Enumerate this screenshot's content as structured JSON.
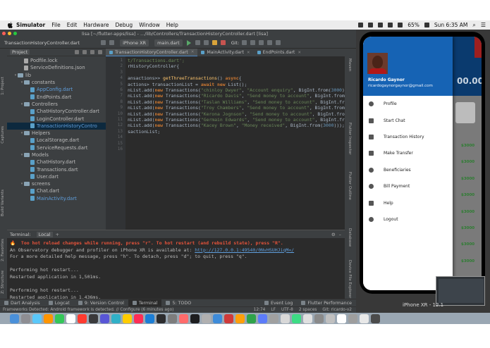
{
  "menubar": {
    "app": "Simulator",
    "items": [
      "File",
      "Edit",
      "Hardware",
      "Debug",
      "Window",
      "Help"
    ],
    "battery": "65%",
    "clock": "Sun 6:35 AM"
  },
  "ide": {
    "window_title": "lisa [~/flutter-apps/lisa] - .../lib/Controllers/TransactionHistoryController.dart [lisa]",
    "breadcrumb": "TransactionHistoryController.dart",
    "device": "iPhone XR",
    "run_config": "main.dart",
    "git_label": "Git:",
    "project_view": "Project",
    "tree": [
      {
        "label": "Podfile.lock",
        "type": "file",
        "indent": 2
      },
      {
        "label": "ServiceDefinitions.json",
        "type": "file",
        "indent": 2
      },
      {
        "label": "lib",
        "type": "folder",
        "indent": 1,
        "arrow": "▾"
      },
      {
        "label": "constants",
        "type": "folder",
        "indent": 2,
        "arrow": "▾"
      },
      {
        "label": "AppConfig.dart",
        "type": "dart",
        "indent": 3,
        "link": true
      },
      {
        "label": "EndPoints.dart",
        "type": "dart",
        "indent": 3
      },
      {
        "label": "Controllers",
        "type": "folder",
        "indent": 2,
        "arrow": "▾"
      },
      {
        "label": "ChatHistoryController.dart",
        "type": "dart",
        "indent": 3
      },
      {
        "label": "LoginController.dart",
        "type": "dart",
        "indent": 3
      },
      {
        "label": "TransactionHistoryContro",
        "type": "dart",
        "indent": 3,
        "selected": true,
        "link": true
      },
      {
        "label": "Helpers",
        "type": "folder",
        "indent": 2,
        "arrow": "▾"
      },
      {
        "label": "LocalStorage.dart",
        "type": "dart",
        "indent": 3
      },
      {
        "label": "ServiceRequests.dart",
        "type": "dart",
        "indent": 3
      },
      {
        "label": "Models",
        "type": "folder",
        "indent": 2,
        "arrow": "▾"
      },
      {
        "label": "ChatHistory.dart",
        "type": "dart",
        "indent": 3
      },
      {
        "label": "Transactions.dart",
        "type": "dart",
        "indent": 3
      },
      {
        "label": "User.dart",
        "type": "dart",
        "indent": 3
      },
      {
        "label": "screens",
        "type": "folder",
        "indent": 2,
        "arrow": "▾"
      },
      {
        "label": "Chat.dart",
        "type": "dart",
        "indent": 3
      },
      {
        "label": "MainActivity.dart",
        "type": "dart",
        "indent": 3,
        "link": true
      }
    ],
    "tabs": [
      "TransactionHistoryController.dart",
      "MainActivity.dart",
      "EndPoints.dart"
    ],
    "line_numbers": [
      "1",
      "2",
      "3",
      "4",
      "5",
      "6",
      "7",
      "8",
      "9",
      "10",
      "11",
      "12",
      "13",
      "14",
      "15",
      "16"
    ],
    "code": {
      "l1": "t/Transactions.dart';",
      "l2": "rHistoryController{",
      "l4_a": "ansactions>> ",
      "l4_fn": "getThreeTransactions",
      "l4_b": "() ",
      "l4_kw": "async",
      "l4_c": "{",
      "l5_a": "actions> transactionList = ",
      "l5_kw1": "await",
      "l5_kw2": "new",
      "l5_b": " List();",
      "rows": [
        {
          "name": "\"chinloy Dwyer\"",
          "msg": "\"Account enquiry\""
        },
        {
          "name": "\"Ricardo Davis\"",
          "msg": "\"Send money to account\""
        },
        {
          "name": "\"Taslan Williams\"",
          "msg": "\"Send money to account\""
        },
        {
          "name": "\"Troy Chambers\"",
          "msg": "\"Send money to account\""
        },
        {
          "name": "\"Kerona Jognson\"",
          "msg": "\"Send money to account\""
        },
        {
          "name": "\"Germain Edwards\"",
          "msg": "\"Send money to account\""
        },
        {
          "name": "\"Kacey Brown\"",
          "msg": "\"Money received\""
        }
      ],
      "last_num": "3000",
      "l14": "sactionList;"
    },
    "terminal": {
      "title": "Terminal:",
      "session": "Local",
      "lines": {
        "warn": "Too hot reload changes while running, press \"r\". To hot restart (and rebuild state), press \"R\".",
        "obs_a": "An Observatory debugger and profiler on iPhone XR is available at: ",
        "obs_url": "http://127.0.0.1:49540/0NvHSUHJiqM=/",
        "help": "For a more detailed help message, press \"h\". To detach, press \"d\"; to quit, press \"q\".",
        "p1": "Performing hot restart...",
        "r1": "Restarted application in 1,501ms.",
        "p2": "Performing hot restart...",
        "r2": "Restarted application in 1,436ms."
      }
    },
    "tool_tabs": [
      "Dart Analysis",
      "Logcat",
      "9: Version Control",
      "Terminal",
      "5: TODO",
      "Event Log",
      "Flutter Performance"
    ],
    "status_left": "Frameworks Detected: Android framework is detected. // Configure (6 minutes ago)",
    "status_right": [
      "12:74",
      "LF",
      "UTF-8",
      "2 spaces",
      "Git: ricardo-v2"
    ],
    "left_strip": [
      "1: Project",
      "Captures",
      "Build Variants",
      "2: Favorites",
      "Z: Structure"
    ],
    "right_strip": [
      "Maven",
      "Flutter Inspector",
      "Flutter Outline",
      "Database",
      "Device File Explorer"
    ]
  },
  "simulator": {
    "status_time": "6:35 AM",
    "user_name": "Ricardo Gaynor",
    "user_email": "ricardogaynorgaynor@gmail.com",
    "menu": [
      "Profile",
      "Start Chat",
      "Transaction History",
      "Make Transfer",
      "Beneficiaries",
      "Bill Payment",
      "Help",
      "Logout"
    ],
    "bg_balance": "00.00",
    "bg_amounts": [
      "$3000",
      "$3000",
      "$3000",
      "$3000",
      "$3000",
      "$3000",
      "$3000",
      "$3000"
    ],
    "device_label": "iPhone XR - 12.1"
  },
  "colors": {
    "drawer_header": "#1663b4",
    "ide_bg": "#2b2b2b",
    "keyword": "#cc7832",
    "string": "#6a8759"
  }
}
